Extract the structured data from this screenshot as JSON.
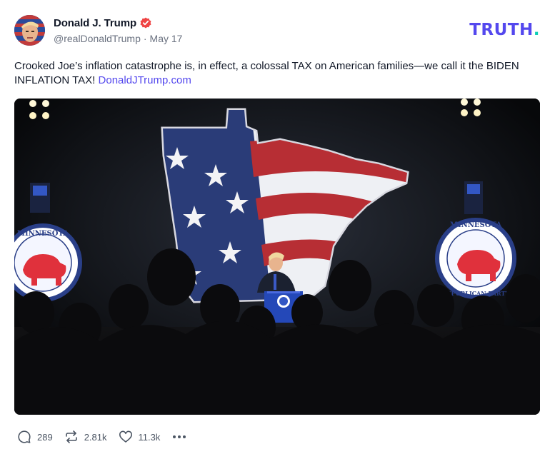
{
  "post": {
    "author_name": "Donald J. Trump",
    "handle": "@realDonaldTrump",
    "separator": "·",
    "date": "May 17",
    "text_before_link": "Crooked Joe’s inflation catastrophe is, in effect, a colossal TAX on American families—we call it the BIDEN INFLATION TAX! ",
    "link_text": "DonaldJTrump.com",
    "verified_icon": "verified-badge-icon"
  },
  "brand": {
    "word": "TRUTH",
    "dot": ".",
    "color": "#5448ee",
    "accent_color": "#0ecfb6"
  },
  "media": {
    "banner_text_left": "MINNESOTA REPUBLICAN PARTY",
    "banner_text_right": "MINNESOTA REPUBLICAN PARTY"
  },
  "actions": {
    "replies": "289",
    "reposts": "2.81k",
    "likes": "11.3k",
    "reply_icon": "comment-icon",
    "repost_icon": "repost-icon",
    "like_icon": "heart-icon",
    "more_icon": "more-options-icon"
  }
}
